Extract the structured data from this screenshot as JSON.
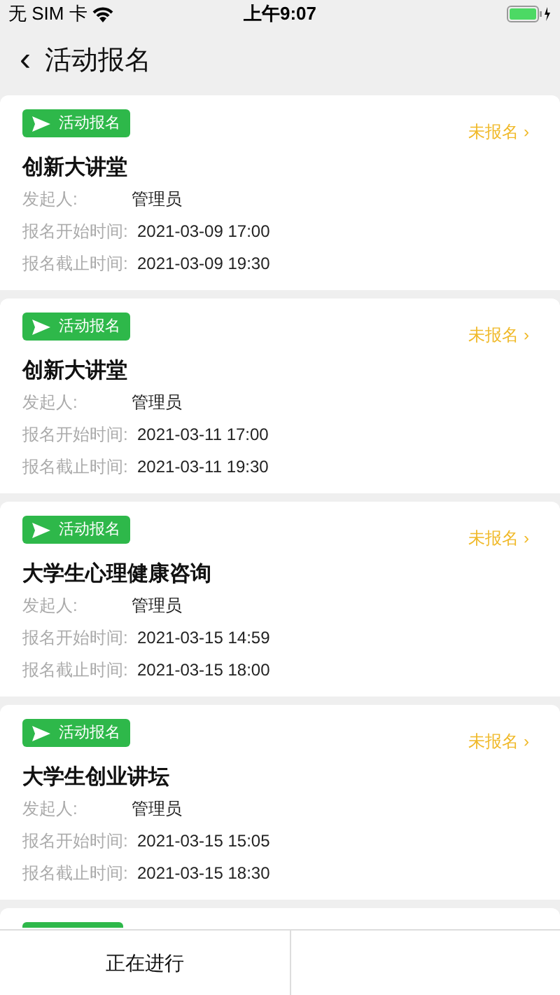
{
  "status_bar": {
    "carrier": "无 SIM 卡",
    "time": "上午9:07"
  },
  "header": {
    "back": "‹",
    "title": "活动报名"
  },
  "activities": [
    {
      "badge": "活动报名",
      "status": "未报名 ›",
      "title": "创新大讲堂",
      "organizer_label": "发起人:",
      "organizer": "管理员",
      "start_label": "报名开始时间:",
      "start": "2021-03-09 17:00",
      "end_label": "报名截止时间:",
      "end": "2021-03-09 19:30"
    },
    {
      "badge": "活动报名",
      "status": "未报名 ›",
      "title": "创新大讲堂",
      "organizer_label": "发起人:",
      "organizer": "管理员",
      "start_label": "报名开始时间:",
      "start": "2021-03-11 17:00",
      "end_label": "报名截止时间:",
      "end": "2021-03-11 19:30"
    },
    {
      "badge": "活动报名",
      "status": "未报名 ›",
      "title": "大学生心理健康咨询",
      "organizer_label": "发起人:",
      "organizer": "管理员",
      "start_label": "报名开始时间:",
      "start": "2021-03-15 14:59",
      "end_label": "报名截止时间:",
      "end": "2021-03-15 18:00"
    },
    {
      "badge": "活动报名",
      "status": "未报名 ›",
      "title": "大学生创业讲坛",
      "organizer_label": "发起人:",
      "organizer": "管理员",
      "start_label": "报名开始时间:",
      "start": "2021-03-15 15:05",
      "end_label": "报名截止时间:",
      "end": "2021-03-15 18:30"
    }
  ],
  "tabs": [
    {
      "label": "正在进行"
    }
  ]
}
